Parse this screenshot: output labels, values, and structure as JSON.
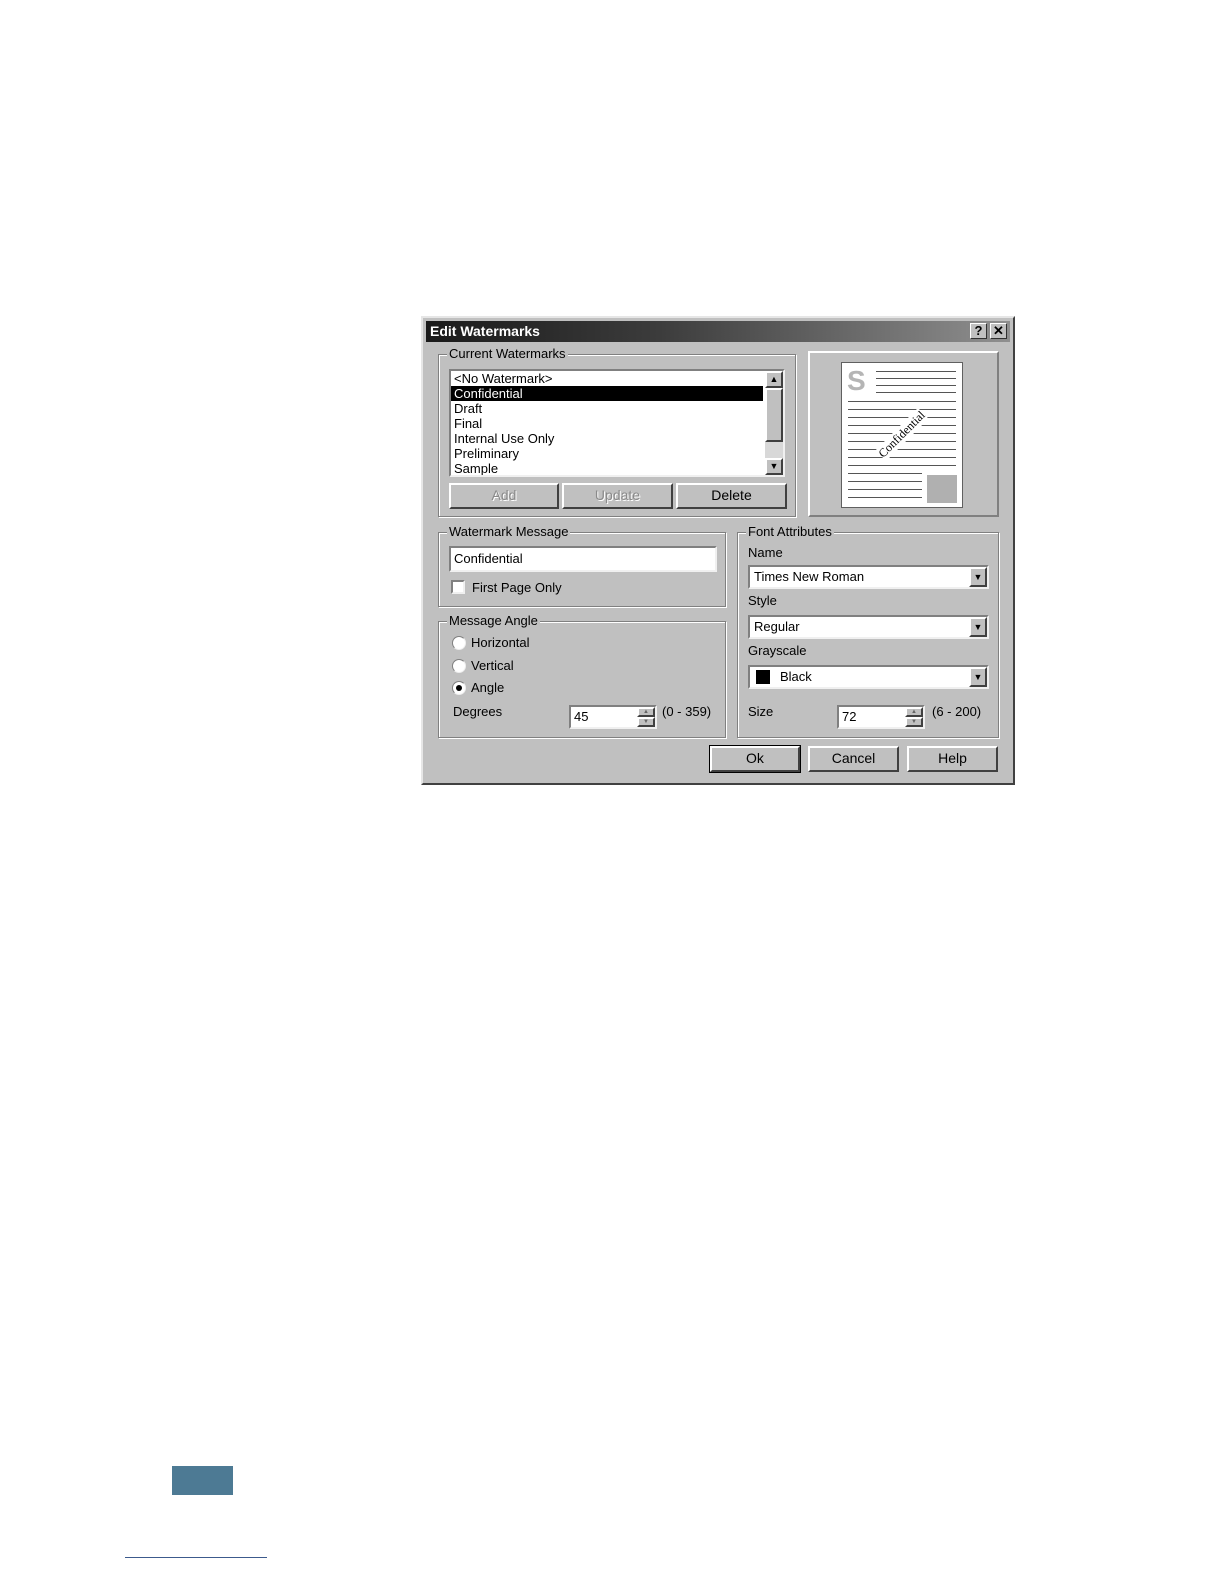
{
  "dialog": {
    "title": "Edit Watermarks",
    "help_glyph": "?",
    "close_glyph": "✕"
  },
  "current_watermarks": {
    "legend": "Current Watermarks",
    "items": [
      "<No Watermark>",
      "Confidential",
      "Draft",
      "Final",
      "Internal Use Only",
      "Preliminary",
      "Sample"
    ],
    "selected": "Confidential",
    "buttons": {
      "add": "Add",
      "update": "Update",
      "delete": "Delete"
    }
  },
  "preview": {
    "initial": "S",
    "watermark_text": "Confidential",
    "colors": {
      "initial": "#b5b5b5",
      "block": "#b0b0b0"
    }
  },
  "watermark_message": {
    "legend": "Watermark Message",
    "value": "Confidential",
    "first_page_only_label": "First Page Only",
    "first_page_only_checked": false
  },
  "message_angle": {
    "legend": "Message Angle",
    "options": [
      "Horizontal",
      "Vertical",
      "Angle"
    ],
    "selected": "Angle",
    "degrees_label": "Degrees",
    "degrees_value": "45",
    "degrees_range": "(0 - 359)"
  },
  "font_attributes": {
    "legend": "Font Attributes",
    "name_label": "Name",
    "name_value": "Times New Roman",
    "style_label": "Style",
    "style_value": "Regular",
    "grayscale_label": "Grayscale",
    "grayscale_value": "Black",
    "grayscale_color": "#000000",
    "size_label": "Size",
    "size_value": "72",
    "size_range": "(6 - 200)"
  },
  "footer_buttons": {
    "ok": "Ok",
    "cancel": "Cancel",
    "help": "Help"
  },
  "colors": {
    "dialog_face": "#c0c0c0",
    "selection": "#000000",
    "page_tab": "#4d7a94"
  }
}
